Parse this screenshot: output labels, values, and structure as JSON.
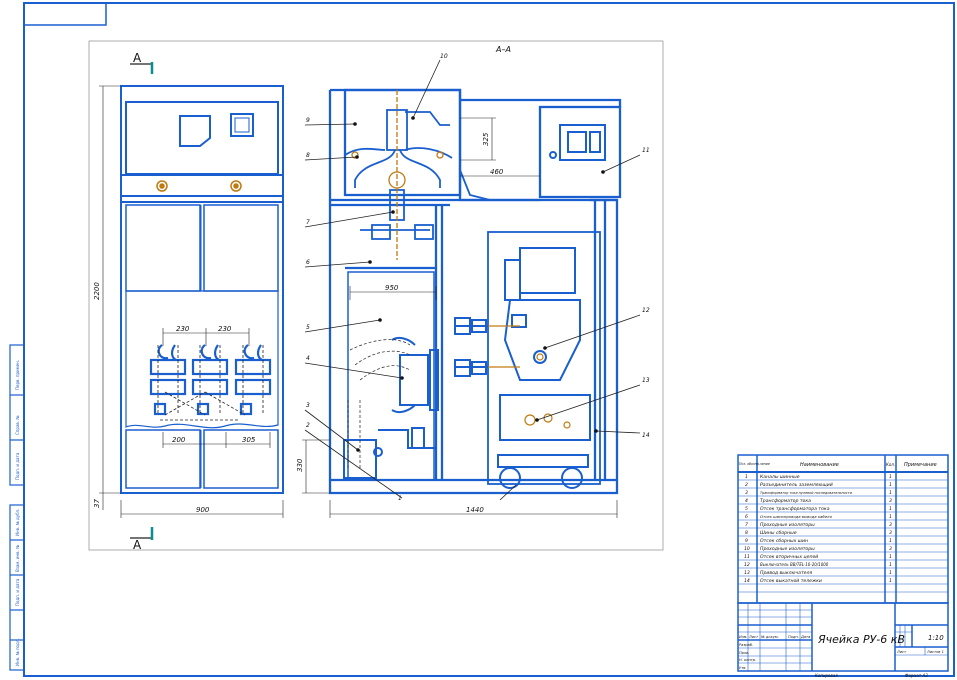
{
  "sheet": {
    "section_label": "А–А",
    "view_mark_top": "А",
    "view_mark_bottom": "А"
  },
  "front_view": {
    "dim_height": "2200",
    "dim_width": "900",
    "dim_230_left": "230",
    "dim_230_right": "230",
    "dim_200": "200",
    "dim_305": "305",
    "dim_bottom_left": "37"
  },
  "section_view": {
    "dim_width": "1440",
    "dim_inner": "950",
    "dim_top_right": "460",
    "dim_vertical_small": "325",
    "dim_bottom_left": "330",
    "callouts": [
      "1",
      "2",
      "3",
      "4",
      "5",
      "6",
      "7",
      "8",
      "9",
      "10",
      "11",
      "12",
      "13",
      "14"
    ]
  },
  "spec_table": {
    "header": [
      "Поз. обозна-чение",
      "Наименование",
      "Кол.",
      "Примечание"
    ],
    "rows": [
      {
        "pos": "1",
        "name": "Каналы шинные",
        "qty": "1"
      },
      {
        "pos": "2",
        "name": "Разъединитель заземляющий",
        "qty": "1"
      },
      {
        "pos": "3",
        "name": "Трансформатор тока нулевой последовательности",
        "qty": "1"
      },
      {
        "pos": "4",
        "name": "Трансформатор тока",
        "qty": "3"
      },
      {
        "pos": "5",
        "name": "Отсек трансформатора тока",
        "qty": "1"
      },
      {
        "pos": "6",
        "name": "Отсек шинопровода вывода кабеля",
        "qty": "1"
      },
      {
        "pos": "7",
        "name": "Проходные изоляторы",
        "qty": "3"
      },
      {
        "pos": "8",
        "name": "Шины сборные",
        "qty": "3"
      },
      {
        "pos": "9",
        "name": "Отсек сборных шин",
        "qty": "1"
      },
      {
        "pos": "10",
        "name": "Проходные изоляторы",
        "qty": "3"
      },
      {
        "pos": "11",
        "name": "Отсек вторичных цепей",
        "qty": "1"
      },
      {
        "pos": "12",
        "name": "Выключатель ВВ/TEL-10-20/1000",
        "qty": "1"
      },
      {
        "pos": "13",
        "name": "Привод выключателя",
        "qty": "1"
      },
      {
        "pos": "14",
        "name": "Отсек выкатной тележки",
        "qty": "1"
      }
    ]
  },
  "title_block": {
    "title": "Ячейка РУ-6 кВ",
    "scale": "1:10",
    "sheet_label": "Лист",
    "sheets_label": "Листов 1",
    "row_labels": [
      "Изм.",
      "Лист",
      "№ докум.",
      "Подп.",
      "Дата",
      "Разраб.",
      "Пров.",
      "Н. контр.",
      "Утв."
    ],
    "copied": "Копировал",
    "format": "Формат А3"
  },
  "side_strip": {
    "labels": [
      "Перв. примен.",
      "Справ. №",
      "Подп. и дата",
      "Инв. № дубл.",
      "Взам. инв. №",
      "Подп. и дата",
      "Инв. № подл."
    ]
  }
}
